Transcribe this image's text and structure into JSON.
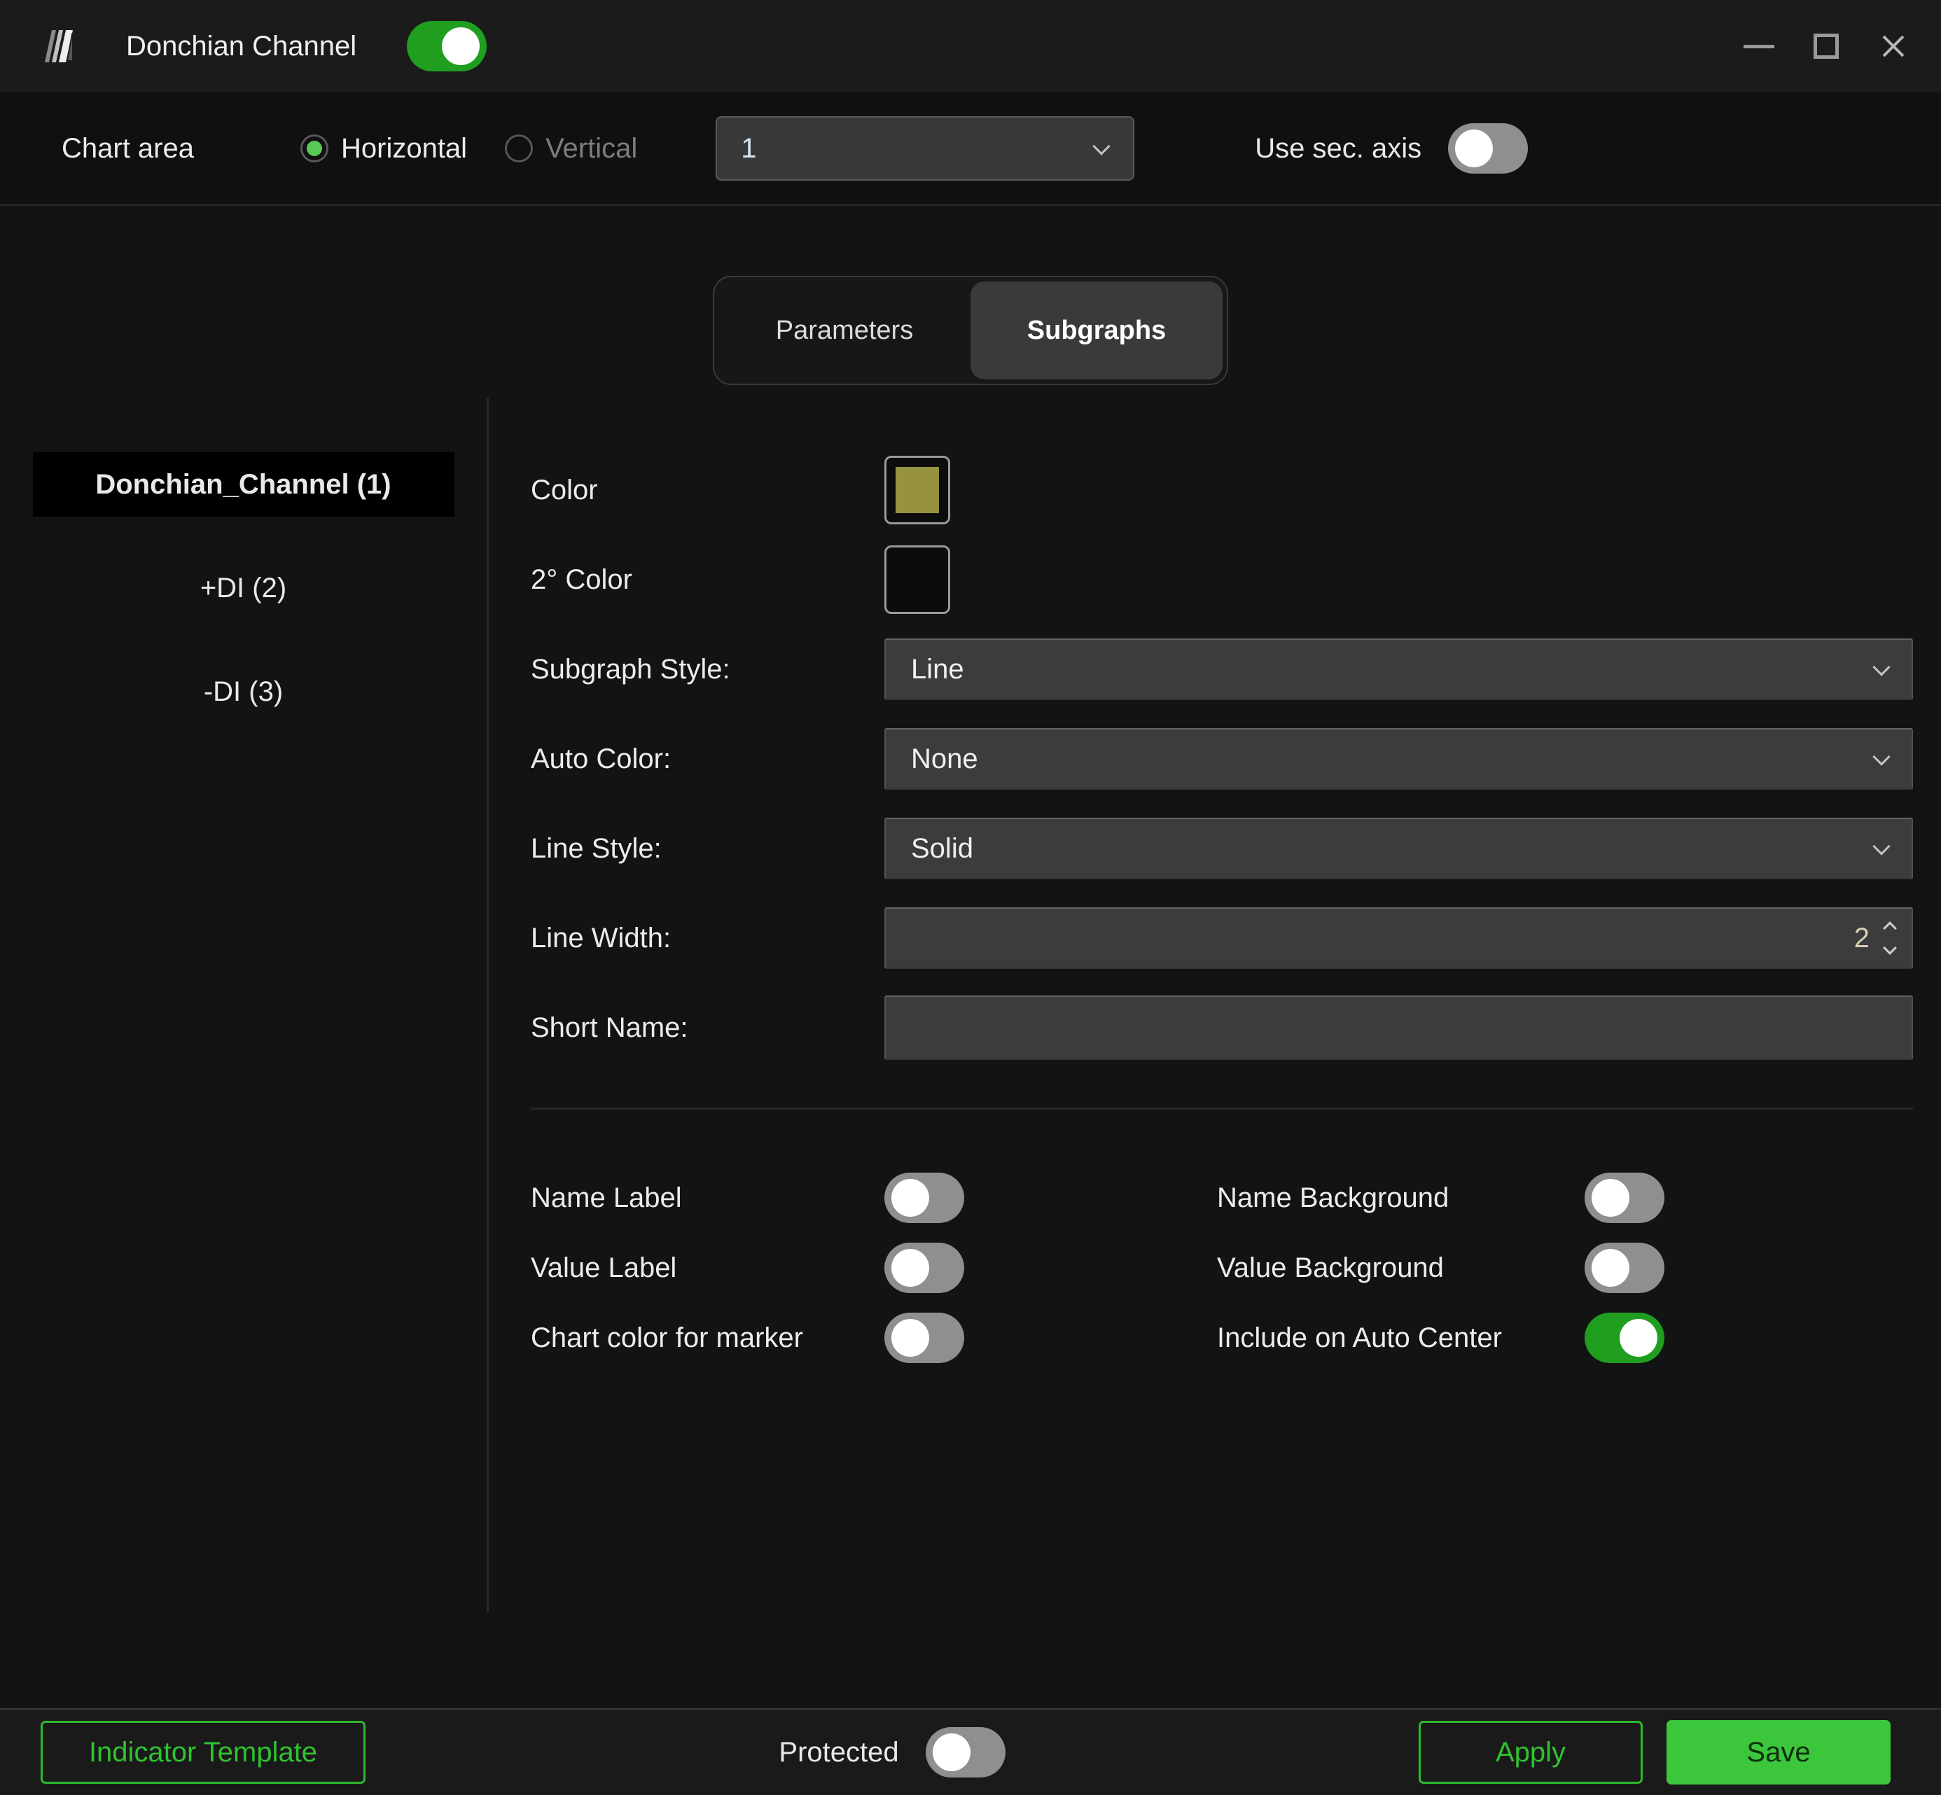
{
  "window": {
    "title": "Donchian Channel",
    "indicator_enabled": true,
    "icons": {
      "logo": "slanted-bars-logo",
      "minimize": "thin-dash",
      "maximize": "hollow-square",
      "close": "x-cross",
      "dropdown": "chevron-down",
      "spinner": "chevron-up-down"
    }
  },
  "chart_area": {
    "label": "Chart area",
    "options": [
      {
        "label": "Horizontal",
        "selected": true
      },
      {
        "label": "Vertical",
        "selected": false
      }
    ],
    "area_value": "1",
    "sec_axis_label": "Use sec. axis",
    "sec_axis_on": false
  },
  "tabs": [
    {
      "label": "Parameters",
      "active": false
    },
    {
      "label": "Subgraphs",
      "active": true
    }
  ],
  "sidebar": {
    "items": [
      {
        "label": "Donchian_Channel (1)",
        "selected": true
      },
      {
        "label": "+DI (2)",
        "selected": false
      },
      {
        "label": "-DI (3)",
        "selected": false
      }
    ]
  },
  "form": {
    "color_label": "Color",
    "color_value": "#97923e",
    "secondary_color_label": "2° Color",
    "secondary_color_value": "",
    "subgraph_style_label": "Subgraph Style:",
    "subgraph_style_value": "Line",
    "auto_color_label": "Auto Color:",
    "auto_color_value": "None",
    "line_style_label": "Line Style:",
    "line_style_value": "Solid",
    "line_width_label": "Line Width:",
    "line_width_value": "2",
    "short_name_label": "Short Name:",
    "short_name_value": ""
  },
  "toggles": {
    "name_label": {
      "label": "Name Label",
      "on": false
    },
    "value_label": {
      "label": "Value Label",
      "on": false
    },
    "chart_color_marker": {
      "label": "Chart color for marker",
      "on": false
    },
    "name_background": {
      "label": "Name Background",
      "on": false
    },
    "value_background": {
      "label": "Value Background",
      "on": false
    },
    "include_auto_center": {
      "label": "Include on Auto Center",
      "on": true
    }
  },
  "footer": {
    "indicator_template": "Indicator Template",
    "protected_label": "Protected",
    "protected_on": false,
    "apply": "Apply",
    "save": "Save"
  },
  "colors": {
    "accent_green": "#2db92d",
    "save_green": "#3cc63c",
    "toggle_on_green": "#1f9e1f",
    "swatch_olive": "#97923e",
    "selected_item_bg": "#000000"
  }
}
